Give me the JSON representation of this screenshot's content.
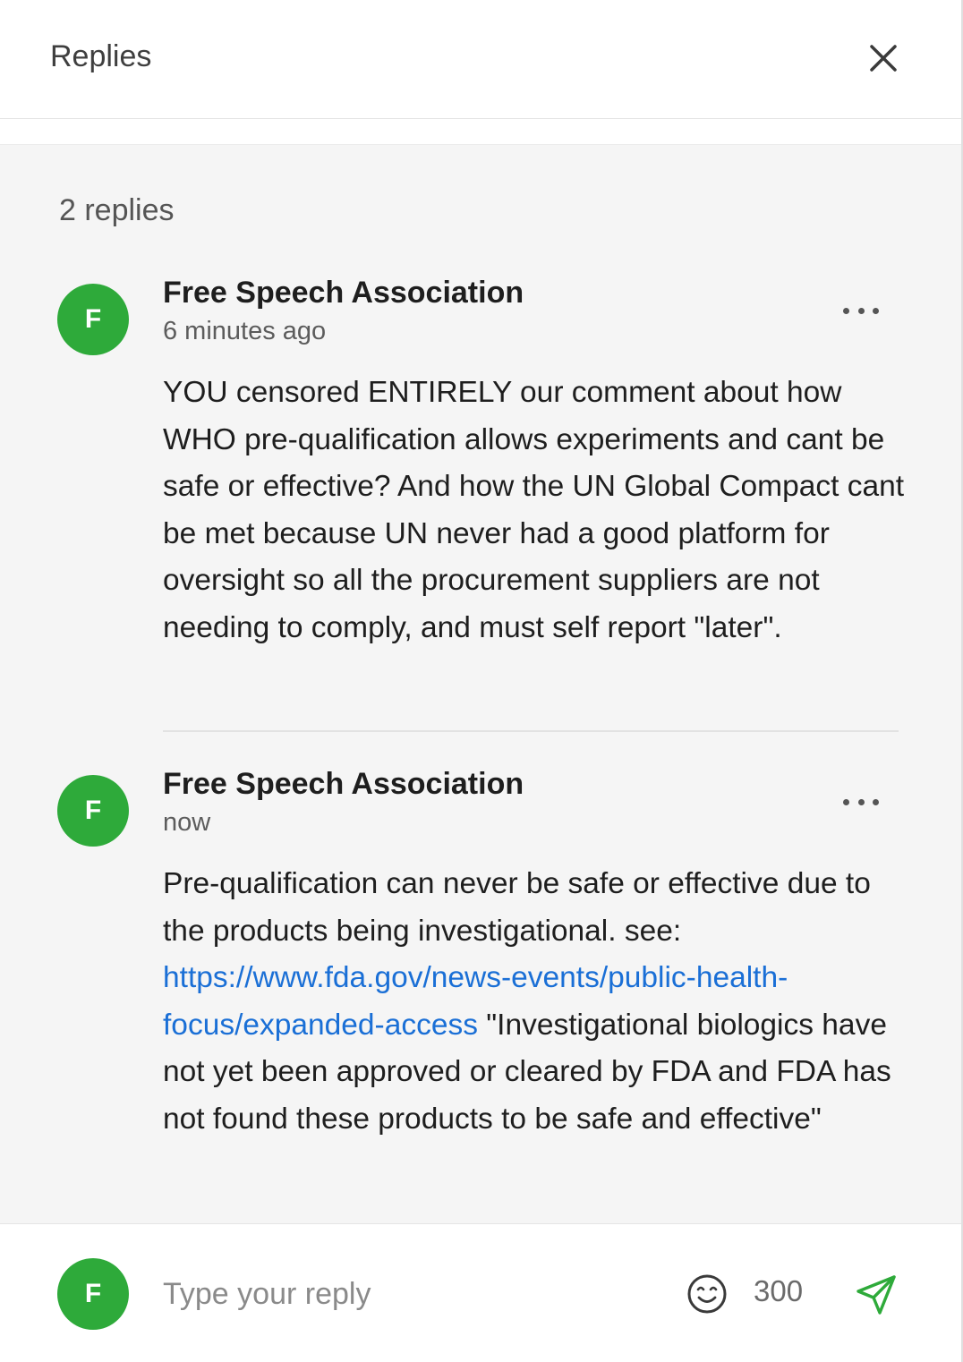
{
  "header": {
    "title": "Replies",
    "close_icon": "close-icon"
  },
  "replies_count_label": "2 replies",
  "replies": [
    {
      "avatar_letter": "F",
      "author": "Free Speech Association",
      "time": "6 minutes ago",
      "menu_icon": "more-horizontal-icon",
      "text": "YOU censored ENTIRELY our comment about how WHO pre-qualification allows experiments and cant be safe or effective? And how the UN Global Compact cant be met because UN never had a good platform for oversight so all the procurement suppliers are not needing to comply, and must self report \"later\"."
    },
    {
      "avatar_letter": "F",
      "author": "Free Speech Association",
      "time": "now",
      "menu_icon": "more-horizontal-icon",
      "text_before_link": "Pre-qualification can never be safe or effective due to the products being investigational. see: ",
      "link_text": "https://www.fda.gov/news-events/public-health-focus/expanded-access",
      "text_after_link": " \"Investigational biologics have not yet been approved or cleared by FDA and FDA has not found these products to be safe and effective\""
    }
  ],
  "composer": {
    "avatar_letter": "F",
    "placeholder": "Type your reply",
    "value": "",
    "emoji_icon": "emoji-smile-icon",
    "char_count": "300",
    "send_icon": "send-icon"
  },
  "colors": {
    "avatar": "#2eaa3a",
    "link": "#1a6fd6",
    "send_icon": "#2eaa3a",
    "content_background": "#f5f5f5"
  }
}
